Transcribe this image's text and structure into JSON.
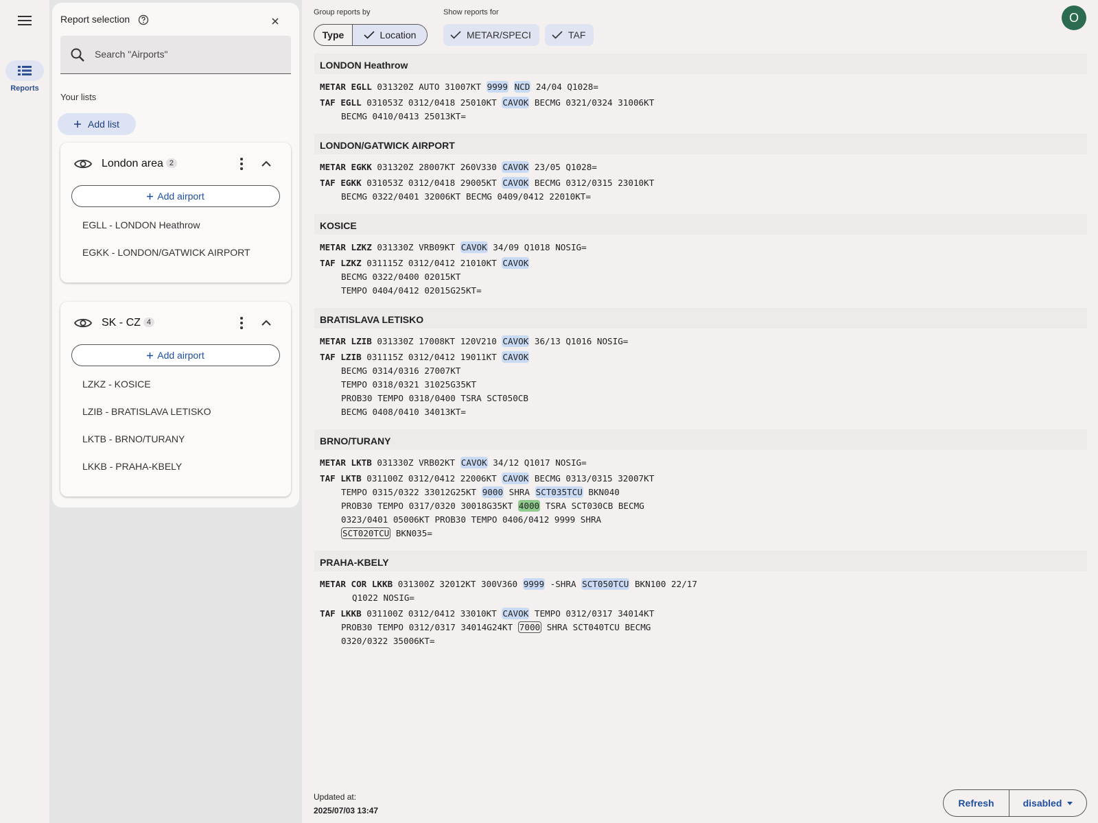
{
  "nav": {
    "menu_icon": "menu-icon",
    "reports_label": "Reports",
    "accent": "#2e4f8f"
  },
  "panel": {
    "title": "Report selection",
    "search_placeholder": "Search \"Airports\"",
    "lists_heading": "Your lists",
    "add_list_label": "Add list",
    "lists": [
      {
        "name": "London area",
        "count": "2",
        "add_airport_label": "Add airport",
        "airports": [
          "EGLL - LONDON Heathrow",
          "EGKK - LONDON/GATWICK AIRPORT"
        ]
      },
      {
        "name": "SK - CZ",
        "count": "4",
        "add_airport_label": "Add airport",
        "airports": [
          "LZKZ - KOSICE",
          "LZIB - BRATISLAVA LETISKO",
          "LKTB - BRNO/TURANY",
          "LKKB - PRAHA-KBELY"
        ]
      }
    ]
  },
  "toolbar": {
    "group_by_label": "Group reports by",
    "group_type": "Type",
    "group_location": "Location",
    "show_for_label": "Show reports for",
    "filter_metar": "METAR/SPECI",
    "filter_taf": "TAF",
    "avatar_initial": "O"
  },
  "stations": [
    {
      "name": "LONDON Heathrow",
      "reports": [
        {
          "lines": [
            [
              [
                "METAR EGLL",
                "kw"
              ],
              [
                " 031320Z AUTO 31007KT ",
                ""
              ],
              [
                "9999",
                "hl"
              ],
              [
                " ",
                ""
              ],
              [
                "NCD",
                "hl"
              ],
              [
                " 24/04 Q1028=",
                ""
              ]
            ]
          ],
          "indent": ""
        },
        {
          "lines": [
            [
              [
                "TAF EGLL",
                "kw"
              ],
              [
                " 031053Z 0312/0418 25010KT ",
                ""
              ],
              [
                "CAVOK",
                "hl"
              ],
              [
                " BECMG 0321/0324 31006KT",
                ""
              ]
            ],
            [
              [
                "BECMG 0410/0413 25013KT=",
                ""
              ]
            ]
          ],
          "indent": "cont1"
        }
      ]
    },
    {
      "name": "LONDON/GATWICK AIRPORT",
      "reports": [
        {
          "lines": [
            [
              [
                "METAR EGKK",
                "kw"
              ],
              [
                " 031320Z 28007KT 260V330 ",
                ""
              ],
              [
                "CAVOK",
                "hl"
              ],
              [
                " 23/05 Q1028=",
                ""
              ]
            ]
          ],
          "indent": ""
        },
        {
          "lines": [
            [
              [
                "TAF EGKK",
                "kw"
              ],
              [
                " 031053Z 0312/0418 29005KT ",
                ""
              ],
              [
                "CAVOK",
                "hl"
              ],
              [
                " BECMG 0312/0315 23010KT",
                ""
              ]
            ],
            [
              [
                "BECMG 0322/0401 32006KT BECMG 0409/0412 22010KT=",
                ""
              ]
            ]
          ],
          "indent": "cont1"
        }
      ]
    },
    {
      "name": "KOSICE",
      "reports": [
        {
          "lines": [
            [
              [
                "METAR LZKZ",
                "kw"
              ],
              [
                " 031330Z VRB09KT ",
                ""
              ],
              [
                "CAVOK",
                "hl"
              ],
              [
                " 34/09 Q1018 NOSIG=",
                ""
              ]
            ]
          ],
          "indent": ""
        },
        {
          "lines": [
            [
              [
                "TAF LZKZ",
                "kw"
              ],
              [
                " 031115Z 0312/0412 21010KT ",
                ""
              ],
              [
                "CAVOK",
                "hl"
              ]
            ],
            [
              [
                "BECMG 0322/0400 02015KT",
                ""
              ]
            ],
            [
              [
                "TEMPO 0404/0412 02015G25KT=",
                ""
              ]
            ]
          ],
          "indent": "cont1"
        }
      ]
    },
    {
      "name": "BRATISLAVA LETISKO",
      "reports": [
        {
          "lines": [
            [
              [
                "METAR LZIB",
                "kw"
              ],
              [
                " 031330Z 17008KT 120V210 ",
                ""
              ],
              [
                "CAVOK",
                "hl"
              ],
              [
                " 36/13 Q1016 NOSIG=",
                ""
              ]
            ]
          ],
          "indent": ""
        },
        {
          "lines": [
            [
              [
                "TAF LZIB",
                "kw"
              ],
              [
                " 031115Z 0312/0412 19011KT ",
                ""
              ],
              [
                "CAVOK",
                "hl"
              ]
            ],
            [
              [
                "BECMG 0314/0316 27007KT",
                ""
              ]
            ],
            [
              [
                "TEMPO 0318/0321 31025G35KT",
                ""
              ]
            ],
            [
              [
                "PROB30 TEMPO 0318/0400 TSRA SCT050CB",
                ""
              ]
            ],
            [
              [
                "BECMG 0408/0410 34013KT=",
                ""
              ]
            ]
          ],
          "indent": "cont1"
        }
      ]
    },
    {
      "name": "BRNO/TURANY",
      "reports": [
        {
          "lines": [
            [
              [
                "METAR LKTB",
                "kw"
              ],
              [
                " 031330Z VRB02KT ",
                ""
              ],
              [
                "CAVOK",
                "hl"
              ],
              [
                " 34/12 Q1017 NOSIG=",
                ""
              ]
            ]
          ],
          "indent": ""
        },
        {
          "lines": [
            [
              [
                "TAF LKTB",
                "kw"
              ],
              [
                " 031100Z 0312/0412 22006KT ",
                ""
              ],
              [
                "CAVOK",
                "hl"
              ],
              [
                " BECMG 0313/0315 32007KT",
                ""
              ]
            ],
            [
              [
                "TEMPO 0315/0322 33012G25KT ",
                ""
              ],
              [
                "9000",
                "hl"
              ],
              [
                " SHRA ",
                ""
              ],
              [
                "SCT035TCU",
                "hl"
              ],
              [
                " BKN040",
                ""
              ]
            ],
            [
              [
                "PROB30 TEMPO 0317/0320 30018G35KT ",
                ""
              ],
              [
                "4000",
                "hlg"
              ],
              [
                " TSRA SCT030CB BECMG",
                ""
              ]
            ],
            [
              [
                "0323/0401 05006KT PROB30 TEMPO 0406/0412 9999 SHRA",
                ""
              ]
            ],
            [
              [
                "SCT020TCU",
                "box"
              ],
              [
                " BKN035=",
                ""
              ]
            ]
          ],
          "indent": "cont1"
        }
      ]
    },
    {
      "name": "PRAHA-KBELY",
      "reports": [
        {
          "lines": [
            [
              [
                "METAR COR LKKB",
                "kw"
              ],
              [
                " 031300Z 32012KT 300V360 ",
                ""
              ],
              [
                "9999",
                "hl"
              ],
              [
                " -SHRA ",
                ""
              ],
              [
                "SCT050TCU",
                "hl"
              ],
              [
                " BKN100 22/17",
                ""
              ]
            ],
            [
              [
                "Q1022 NOSIG=",
                ""
              ]
            ]
          ],
          "indent": "cont2"
        },
        {
          "lines": [
            [
              [
                "TAF LKKB",
                "kw"
              ],
              [
                " 031100Z 0312/0412 33010KT ",
                ""
              ],
              [
                "CAVOK",
                "hl"
              ],
              [
                " TEMPO 0312/0317 34014KT",
                ""
              ]
            ],
            [
              [
                "PROB30 TEMPO 0312/0317 34014G24KT ",
                ""
              ],
              [
                "7000",
                "box"
              ],
              [
                " SHRA SCT040TCU BECMG",
                ""
              ]
            ],
            [
              [
                "0320/0322 35006KT=",
                ""
              ]
            ]
          ],
          "indent": "cont1"
        }
      ]
    }
  ],
  "footer": {
    "updated_label": "Updated at:",
    "updated_value": "2025/07/03 13:47",
    "refresh_label": "Refresh",
    "refresh_mode": "disabled"
  }
}
